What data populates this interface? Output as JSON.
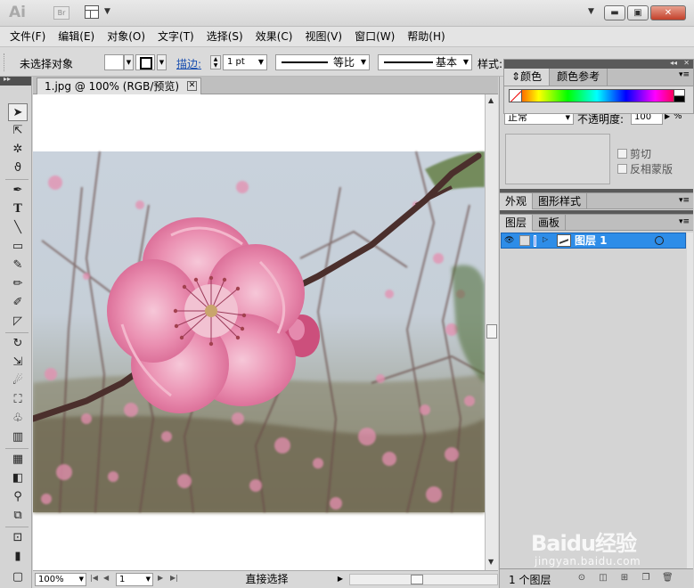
{
  "app": {
    "logo": "Ai",
    "bridge_label": "Br"
  },
  "menu": [
    "文件(F)",
    "编辑(E)",
    "对象(O)",
    "文字(T)",
    "选择(S)",
    "效果(C)",
    "视图(V)",
    "窗口(W)",
    "帮助(H)"
  ],
  "control_bar": {
    "selection_label": "未选择对象",
    "stroke_link": "描边:",
    "stroke_weight": "1 pt",
    "profile_label": "等比",
    "brush_label": "基本",
    "style_label": "样式:"
  },
  "color_panel": {
    "tabs": [
      "颜色",
      "颜色参考"
    ]
  },
  "transparency": {
    "blend_mode": "正常",
    "opacity_label": "不透明度:",
    "opacity_value": "100",
    "opacity_unit": "%",
    "clip_label": "剪切",
    "invert_label": "反相蒙版"
  },
  "appearance_tabs": [
    "外观",
    "图形样式"
  ],
  "layers_tabs": [
    "图层",
    "画板"
  ],
  "layers": [
    {
      "name": "图层 1",
      "selected": true,
      "color": "#4e7cf0"
    }
  ],
  "layers_footer": {
    "count": "1 个图层"
  },
  "document": {
    "tab_title": "1.jpg @ 100% (RGB/预览)",
    "zoom": "100%",
    "page": "1",
    "status": "直接选择"
  },
  "tools": [
    "selection-tool",
    "direct-selection-tool",
    "magic-wand-tool",
    "lasso-tool",
    "pen-tool",
    "type-tool",
    "line-tool",
    "rectangle-tool",
    "paintbrush-tool",
    "pencil-tool",
    "blob-brush-tool",
    "eraser-tool",
    "rotate-tool",
    "scale-tool",
    "warp-tool",
    "free-transform-tool",
    "symbol-sprayer-tool",
    "column-graph-tool",
    "mesh-tool",
    "gradient-tool",
    "eyedropper-tool",
    "blend-tool",
    "slice-tool",
    "artboard-tool",
    "screen-mode-tool"
  ],
  "watermark": {
    "logo": "Baidu经验",
    "url": "jingyan.baidu.com"
  },
  "colors": {
    "layer_highlight": "#2e8de8",
    "stroke_link": "#1a4fb0"
  }
}
